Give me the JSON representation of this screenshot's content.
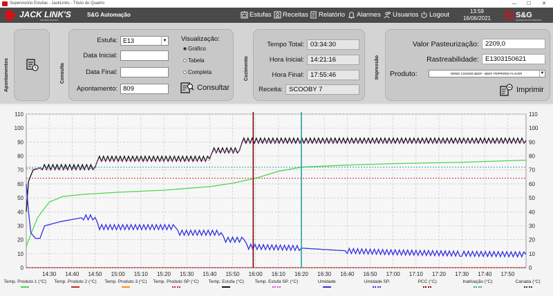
{
  "window": {
    "title": "Supervisório Estufas - JackLinks - Título do Quadro",
    "controls": [
      "—",
      "☐",
      "✕"
    ]
  },
  "topbar": {
    "brand": "JACK LINK'S",
    "brand_sub": "PROTEIN SNACKS",
    "company": "S&G Automação",
    "nav": [
      {
        "label": "Estufas",
        "icon": "oven-icon"
      },
      {
        "label": "Receitas",
        "icon": "recipe-icon"
      },
      {
        "label": "Relatório",
        "icon": "report-icon"
      },
      {
        "label": "Alarmes",
        "icon": "bell-icon"
      },
      {
        "label": "Usuarios",
        "icon": "users-icon"
      },
      {
        "label": "Logout",
        "icon": "power-icon"
      }
    ],
    "time": "13:59",
    "date": "16/06/2021",
    "sg_logo": "S&G",
    "sg_sub": "ELÉTRICA E AUTOMAÇÃO"
  },
  "apontamentos": {
    "section": "Apontamentos"
  },
  "consulta": {
    "section": "Consulta",
    "estufa_label": "Estufa:",
    "estufa_value": "E13",
    "data_inicial_label": "Data Inicial:",
    "data_inicial_value": "",
    "data_final_label": "Data Final:",
    "data_final_value": "",
    "apontamento_label": "Apontamento:",
    "apontamento_value": "809",
    "visualizacao_label": "Visualização:",
    "options": [
      "Gráfico",
      "Tabela",
      "Completa"
    ],
    "selected": "Gráfico",
    "consultar_label": "Consultar"
  },
  "cozimento": {
    "section": "Cozimento",
    "tempo_total_label": "Tempo Total:",
    "tempo_total": "03:34:30",
    "hora_inicial_label": "Hora Inicial:",
    "hora_inicial": "14:21:16",
    "hora_final_label": "Hora Final:",
    "hora_final": "17:55:46",
    "receita_label": "Receita:",
    "receita": "SCOOBY 7"
  },
  "impressao": {
    "section": "Impressão",
    "valor_label": "Valor Pasteurização:",
    "valor": "2209,0",
    "rastreabilidade_label": "Rastreabilidade:",
    "rastreabilidade": "E1303150621",
    "produto_label": "Produto:",
    "produto": "DRIED COOKED BEEF - BEEF PEPPERED FLAVOR",
    "imprimir_label": "Imprimir"
  },
  "chart_data": {
    "type": "line",
    "ylim": [
      0,
      110
    ],
    "yticks": [
      "0",
      "10",
      "20",
      "30",
      "40",
      "50",
      "60",
      "70",
      "80",
      "90",
      "100",
      "110"
    ],
    "x_range": [
      "14:20",
      "17:58"
    ],
    "xticks": [
      "14:30",
      "14:40",
      "14:50",
      "15:00",
      "15:10",
      "15:20",
      "15:30",
      "15:40",
      "15:50",
      "16:00",
      "16:10",
      "16:20",
      "16:30",
      "16:40",
      "16:50",
      "17:00",
      "17:10",
      "17:20",
      "17:30",
      "17:40",
      "17:50"
    ],
    "grid": true,
    "vlines": [
      {
        "x": "15:59",
        "color": "#8b0000"
      },
      {
        "x": "16:20",
        "color": "#20a0a0"
      }
    ],
    "series": [
      {
        "name": "Temp. Produto 1 (°C)",
        "color": "#4cd64c",
        "style": "solid",
        "points": [
          [
            "14:20",
            15
          ],
          [
            "14:22",
            24
          ],
          [
            "14:25",
            36
          ],
          [
            "14:30",
            47
          ],
          [
            "14:36",
            51
          ],
          [
            "14:45",
            52.5
          ],
          [
            "15:00",
            54
          ],
          [
            "15:20",
            55.5
          ],
          [
            "15:40",
            58
          ],
          [
            "15:50",
            60.5
          ],
          [
            "16:00",
            64
          ],
          [
            "16:10",
            69
          ],
          [
            "16:20",
            72
          ],
          [
            "16:40",
            73.5
          ],
          [
            "17:00",
            74.5
          ],
          [
            "17:30",
            75.5
          ],
          [
            "17:58",
            77
          ]
        ]
      },
      {
        "name": "Temp. Produto 2 (°C)",
        "color": "#cc2222",
        "style": "solid",
        "points": [
          [
            "14:20",
            0
          ],
          [
            "17:58",
            0
          ]
        ]
      },
      {
        "name": "Temp. Produto 3 (°C)",
        "color": "#ff8c1a",
        "style": "solid",
        "points": [
          [
            "14:20",
            0
          ],
          [
            "17:58",
            0
          ]
        ]
      },
      {
        "name": "Temp. Produto SP (°C)",
        "color": "#cc2222",
        "style": "dotted",
        "points": [
          [
            "14:20",
            64
          ],
          [
            "17:58",
            64
          ]
        ]
      },
      {
        "name": "Temp. Estufa (°C)",
        "color": "#111111",
        "style": "zigzag",
        "points": [
          [
            "14:20",
            40
          ],
          [
            "14:21",
            62
          ],
          [
            "14:23",
            70
          ],
          [
            "14:27",
            72
          ],
          [
            "14:50",
            72
          ],
          [
            "14:51",
            78
          ],
          [
            "15:40",
            78
          ],
          [
            "15:41",
            84
          ],
          [
            "15:53",
            84
          ],
          [
            "15:54",
            91
          ],
          [
            "17:58",
            91
          ]
        ]
      },
      {
        "name": "Temp. Estufa SP. (°C)",
        "color": "#e040e0",
        "style": "dotted",
        "points": [
          [
            "14:20",
            71
          ],
          [
            "14:50",
            71
          ],
          [
            "14:51",
            77
          ],
          [
            "15:40",
            77
          ],
          [
            "15:41",
            83
          ],
          [
            "15:53",
            83
          ],
          [
            "15:54",
            90
          ],
          [
            "17:58",
            90
          ]
        ]
      },
      {
        "name": "Umidade",
        "color": "#3030e0",
        "style": "zigzag",
        "points": [
          [
            "14:20",
            60
          ],
          [
            "14:21",
            40
          ],
          [
            "14:22",
            25
          ],
          [
            "14:24",
            21
          ],
          [
            "14:26",
            21
          ],
          [
            "14:28",
            30
          ],
          [
            "14:35",
            33
          ],
          [
            "14:45",
            36
          ],
          [
            "14:50",
            36
          ],
          [
            "14:52",
            29
          ],
          [
            "15:25",
            29
          ],
          [
            "15:27",
            25
          ],
          [
            "15:45",
            25
          ],
          [
            "15:47",
            20
          ],
          [
            "15:55",
            20
          ],
          [
            "15:57",
            15
          ],
          [
            "16:20",
            14
          ],
          [
            "16:40",
            12
          ],
          [
            "17:00",
            11
          ],
          [
            "17:30",
            10
          ],
          [
            "17:58",
            9.5
          ]
        ]
      },
      {
        "name": "Umidade SP.",
        "color": "#3030e0",
        "style": "dotted",
        "points": [
          [
            "14:20",
            0
          ],
          [
            "17:58",
            0
          ]
        ]
      },
      {
        "name": "PCC  (°C)",
        "color": "#8b0000",
        "style": "dotted",
        "points": []
      },
      {
        "name": "Inativação  (°C)",
        "color": "#20a0a0",
        "style": "dotted",
        "points": [
          [
            "14:20",
            72
          ],
          [
            "17:58",
            72
          ]
        ]
      },
      {
        "name": "Canada  (°C)",
        "color": "#333333",
        "style": "dotted",
        "points": []
      }
    ]
  }
}
